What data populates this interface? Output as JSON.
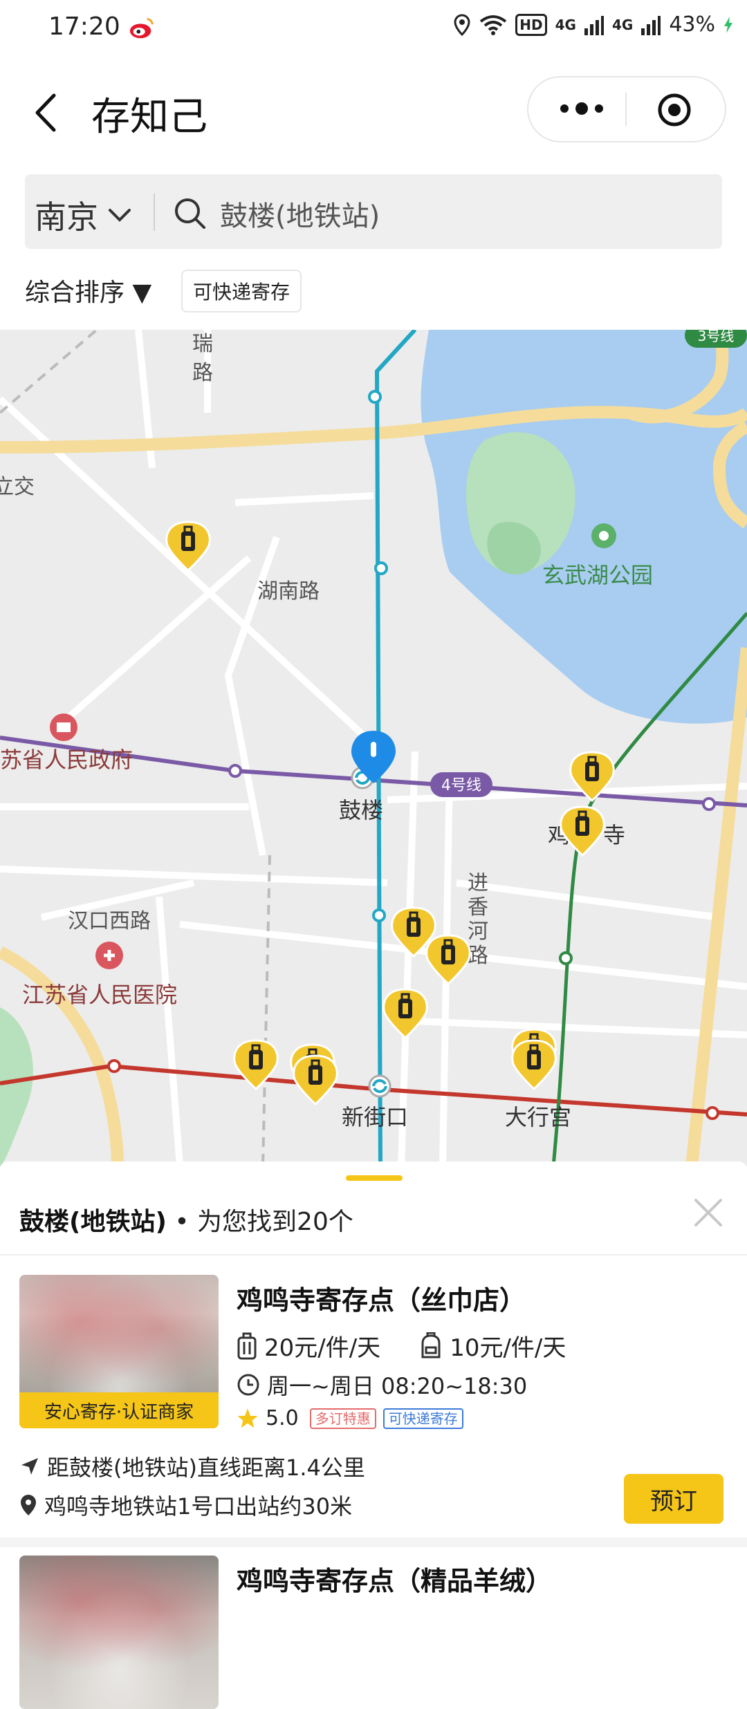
{
  "status_bar": {
    "time": "17:20",
    "network_hd": "HD",
    "signal_1": "4G",
    "signal_2": "4G",
    "battery": "43%"
  },
  "header": {
    "title": "存知己"
  },
  "search": {
    "city": "南京",
    "query": "鼓楼(地铁站)"
  },
  "filters": {
    "sort_label": "综合排序 ▼",
    "express_chip": "可快递寄存"
  },
  "map": {
    "place_labels": [
      "瑞",
      "路",
      "立交",
      "湖南路",
      "玄武湖公园",
      "苏省人民政府",
      "鼓楼",
      "4号线",
      "汉口西路",
      "进",
      "香",
      "河",
      "路",
      "鸡",
      "寺",
      "江苏省人民医院",
      "新街口",
      "大行宫",
      "3号线"
    ]
  },
  "sheet": {
    "station": "鼓楼(地铁站)",
    "result_text": "• 为您找到20个",
    "listings": [
      {
        "name": "鸡鸣寺寄存点（丝巾店）",
        "price_suitcase": "20元/件/天",
        "price_bag": "10元/件/天",
        "hours": "周一~周日 08:20~18:30",
        "rating": "5.0",
        "tag_deal": "多订特惠",
        "tag_express": "可快递寄存",
        "badge": "安心寄存·认证商家",
        "distance": "距鼓楼(地铁站)直线距离1.4公里",
        "location": "鸡鸣寺地铁站1号口出站约30米",
        "book_label": "预订"
      },
      {
        "name": "鸡鸣寺寄存点（精品羊绒）"
      }
    ]
  }
}
